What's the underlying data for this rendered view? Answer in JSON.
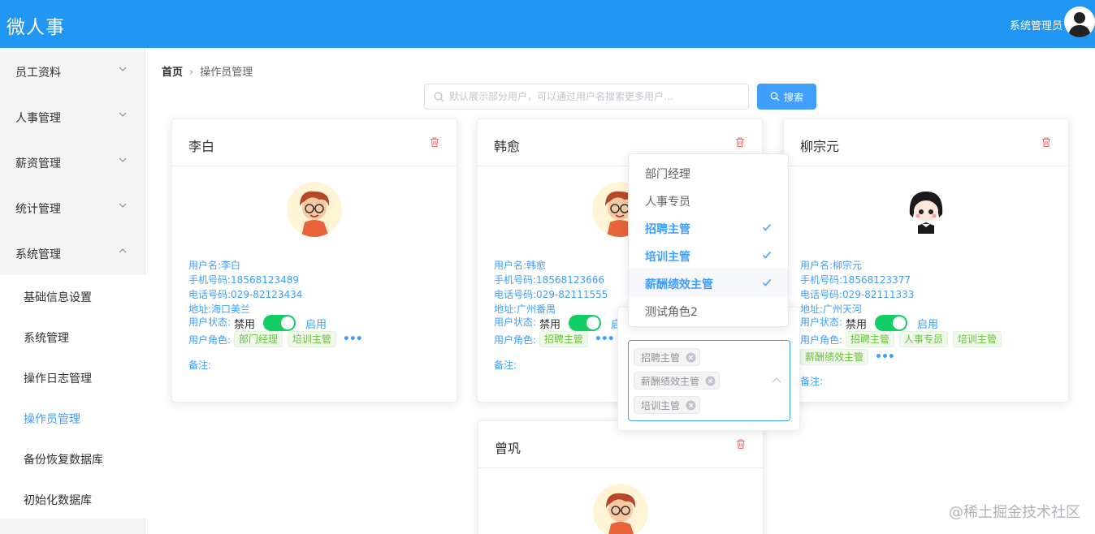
{
  "header": {
    "brand": "微人事",
    "user": "系统管理员"
  },
  "sidebar": {
    "menus": [
      {
        "label": "员工资料",
        "expanded": false
      },
      {
        "label": "人事管理",
        "expanded": false
      },
      {
        "label": "薪资管理",
        "expanded": false
      },
      {
        "label": "统计管理",
        "expanded": false
      },
      {
        "label": "系统管理",
        "expanded": true
      }
    ],
    "submenu": [
      {
        "label": "基础信息设置"
      },
      {
        "label": "系统管理"
      },
      {
        "label": "操作日志管理"
      },
      {
        "label": "操作员管理",
        "active": true
      },
      {
        "label": "备份恢复数据库"
      },
      {
        "label": "初始化数据库"
      }
    ]
  },
  "breadcrumb": {
    "home": "首页",
    "current": "操作员管理"
  },
  "search": {
    "placeholder": "默认展示部分用户，可以通过用户名搜索更多用户...",
    "value": "",
    "button": "搜索"
  },
  "cards": [
    {
      "name": "李白",
      "username": "用户名:李白",
      "mobile": "手机号码:18568123489",
      "phone": "电话号码:029-82123434",
      "address": "地址:海口美兰",
      "status_label": "用户状态:",
      "off": "禁用",
      "on": "启用",
      "role_label": "用户角色:",
      "roles": [
        "部门经理",
        "培训主管"
      ],
      "remark": "备注:"
    },
    {
      "name": "韩愈",
      "username": "用户名:韩愈",
      "mobile": "手机号码:18568123666",
      "phone": "电话号码:029-82111555",
      "address": "地址:广州番禺",
      "status_label": "用户状态:",
      "off": "禁用",
      "on": "启",
      "role_label": "用户角色:",
      "roles": [
        "招聘主管"
      ],
      "remark": "备注:"
    },
    {
      "name": "柳宗元",
      "username": "用户名:柳宗元",
      "mobile": "手机号码:18568123377",
      "phone": "电话号码:029-82111333",
      "address": "地址:广州天河",
      "status_label": "用户状态:",
      "off": "禁用",
      "on": "启用",
      "role_label": "用户角色:",
      "roles": [
        "招聘主管",
        "人事专员",
        "培训主管",
        "薪酬绩效主管"
      ],
      "remark": "备注:"
    },
    {
      "name": "曾巩"
    }
  ],
  "role_dropdown": {
    "options": [
      {
        "label": "部门经理",
        "selected": false
      },
      {
        "label": "人事专员",
        "selected": false
      },
      {
        "label": "招聘主管",
        "selected": true
      },
      {
        "label": "培训主管",
        "selected": true
      },
      {
        "label": "薪酬绩效主管",
        "selected": true
      },
      {
        "label": "测试角色2",
        "selected": false
      }
    ],
    "selected_tags": [
      "招聘主管",
      "薪酬绩效主管",
      "培训主管"
    ]
  },
  "watermark": "@稀土掘金技术社区",
  "colors": {
    "header": "#2296f3",
    "primary": "#409eff",
    "success": "#13ce66",
    "danger": "#f56c6c"
  }
}
